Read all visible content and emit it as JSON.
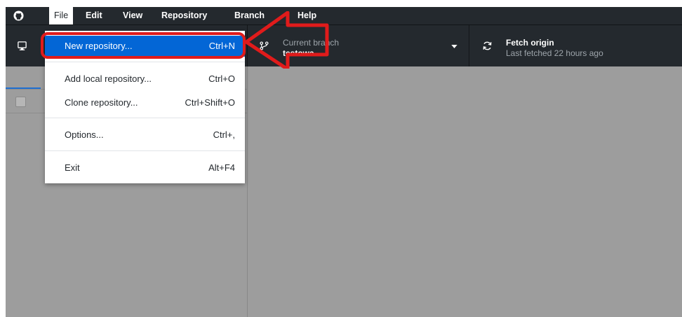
{
  "menubar": {
    "items": [
      "File",
      "Edit",
      "View",
      "Repository",
      "Branch",
      "Help"
    ]
  },
  "toolbar": {
    "branch_label": "Current branch",
    "branch_name": "testowa",
    "fetch_label": "Fetch origin",
    "fetch_sub": "Last fetched 22 hours ago"
  },
  "file_menu": {
    "items": [
      {
        "label": "New repository...",
        "shortcut": "Ctrl+N",
        "highlighted": true
      },
      {
        "label": "Add local repository...",
        "shortcut": "Ctrl+O"
      },
      {
        "label": "Clone repository...",
        "shortcut": "Ctrl+Shift+O"
      },
      {
        "label": "Options...",
        "shortcut": "Ctrl+,"
      },
      {
        "label": "Exit",
        "shortcut": "Alt+F4"
      }
    ]
  },
  "colors": {
    "chrome": "#24292e",
    "overlay": "#9d9d9d",
    "highlight": "#0366d6",
    "annotation": "#e01b1b"
  },
  "icons": {
    "logo": "github-logo-icon",
    "repository": "desktop-icon",
    "branch": "git-branch-icon",
    "caret": "caret-down-icon",
    "fetch": "sync-icon"
  }
}
